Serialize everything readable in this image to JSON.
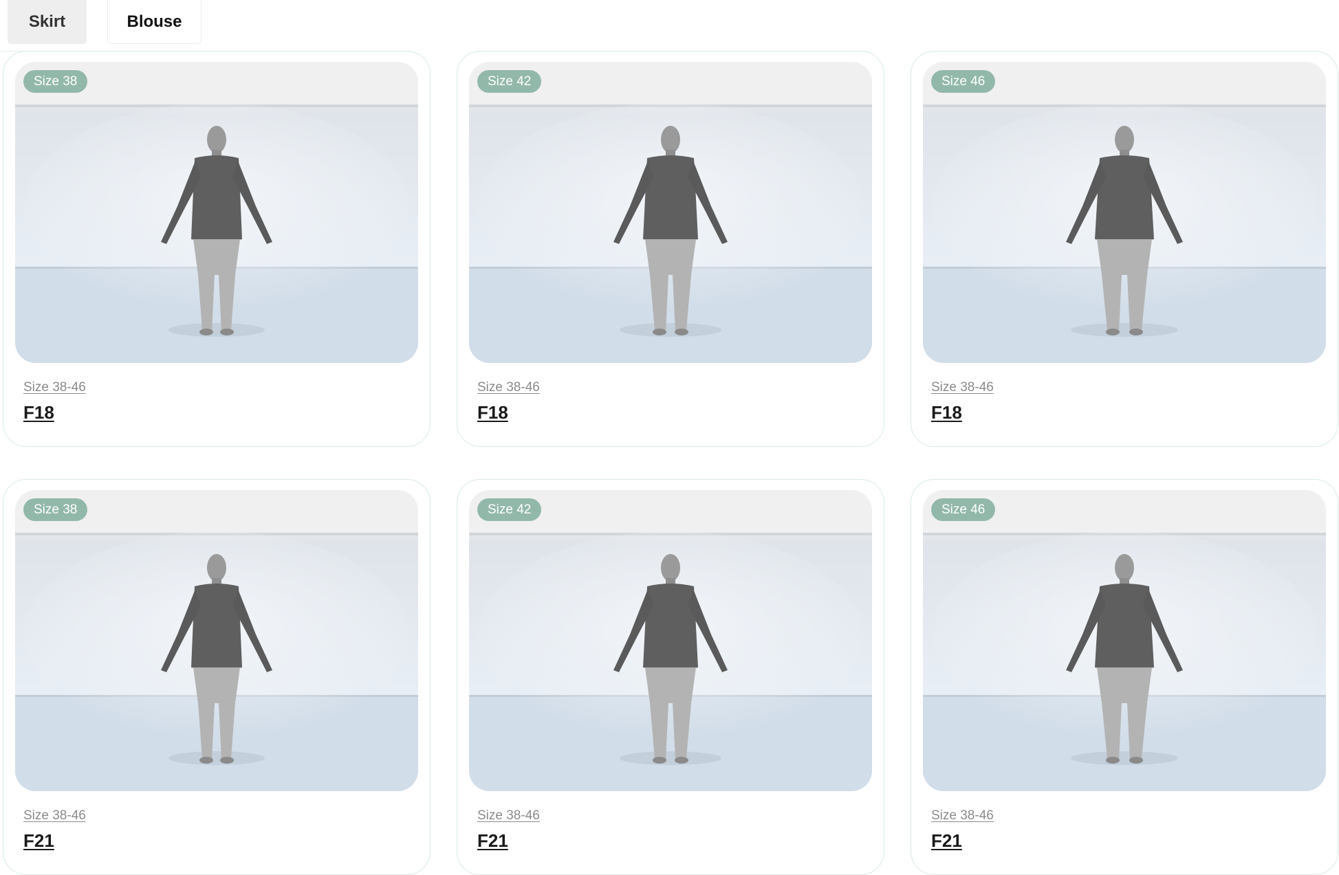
{
  "tabs": [
    {
      "label": "Skirt"
    },
    {
      "label": "Blouse"
    }
  ],
  "cards": [
    {
      "badge": "Size 38",
      "range": "Size 38-46",
      "model": "F18"
    },
    {
      "badge": "Size 42",
      "range": "Size 38-46",
      "model": "F18"
    },
    {
      "badge": "Size 46",
      "range": "Size 38-46",
      "model": "F18"
    },
    {
      "badge": "Size 38",
      "range": "Size 38-46",
      "model": "F21"
    },
    {
      "badge": "Size 42",
      "range": "Size 38-46",
      "model": "F21"
    },
    {
      "badge": "Size 46",
      "range": "Size 38-46",
      "model": "F21"
    }
  ],
  "colors": {
    "badge_bg": "#92b8aa",
    "card_border": "#d8ebe5",
    "tab_active_bg": "#eeeeee"
  },
  "icons": {
    "avatar_preview": "avatar-3d-preview"
  }
}
